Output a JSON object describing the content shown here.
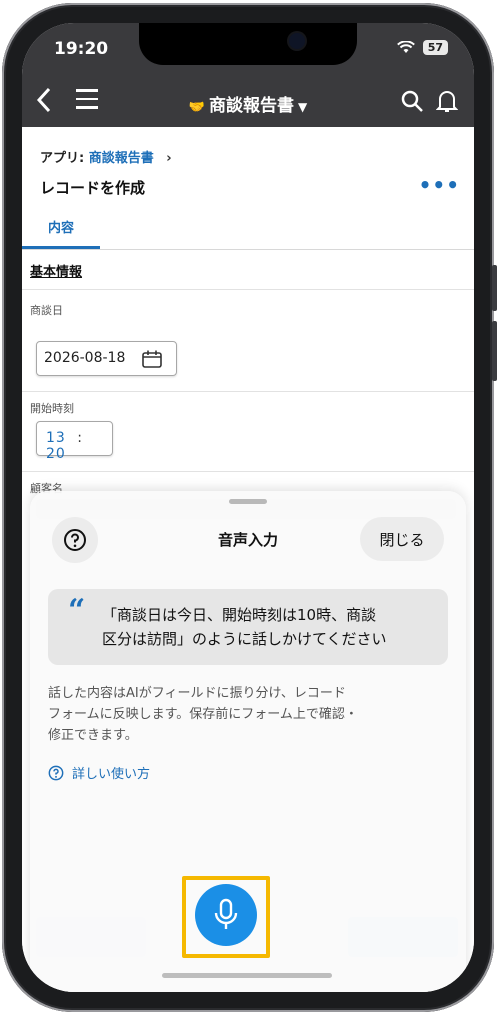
{
  "status": {
    "time": "19:20",
    "battery": "57"
  },
  "appbar": {
    "title": "商談報告書",
    "emoji": "🤝"
  },
  "breadcrumb": {
    "prefix": "アプリ:",
    "link": "商談報告書"
  },
  "record": {
    "title": "レコードを作成",
    "more": "•••"
  },
  "tabs": [
    {
      "label": "内容",
      "active": true
    }
  ],
  "form": {
    "section": "基本情報",
    "date_label": "商談日",
    "date_value": "2026-08-18",
    "start_label": "開始時刻",
    "start_hour": "13",
    "start_min": "20",
    "customer_label": "顧客名"
  },
  "sheet": {
    "title": "音声入力",
    "close_label": "閉じる",
    "hint_line1": "「商談日は今日、開始時刻は10時、商談",
    "hint_line2": "区分は訪問」のように話しかけてください",
    "desc_line1": "話した内容はAIがフィールドに振り分け、レコード",
    "desc_line2": "フォームに反映します。保存前にフォーム上で確認・",
    "desc_line3": "修正できます。",
    "howto": "詳しい使い方"
  },
  "colors": {
    "accent": "#1e6fb8",
    "mic": "#1b8fe6",
    "highlight": "#f5b800",
    "appbar": "#3a3a3d"
  },
  "icons": [
    "back-icon",
    "menu-icon",
    "search-icon",
    "bell-icon",
    "calendar-icon",
    "help-icon",
    "quote-icon",
    "microphone-icon"
  ]
}
